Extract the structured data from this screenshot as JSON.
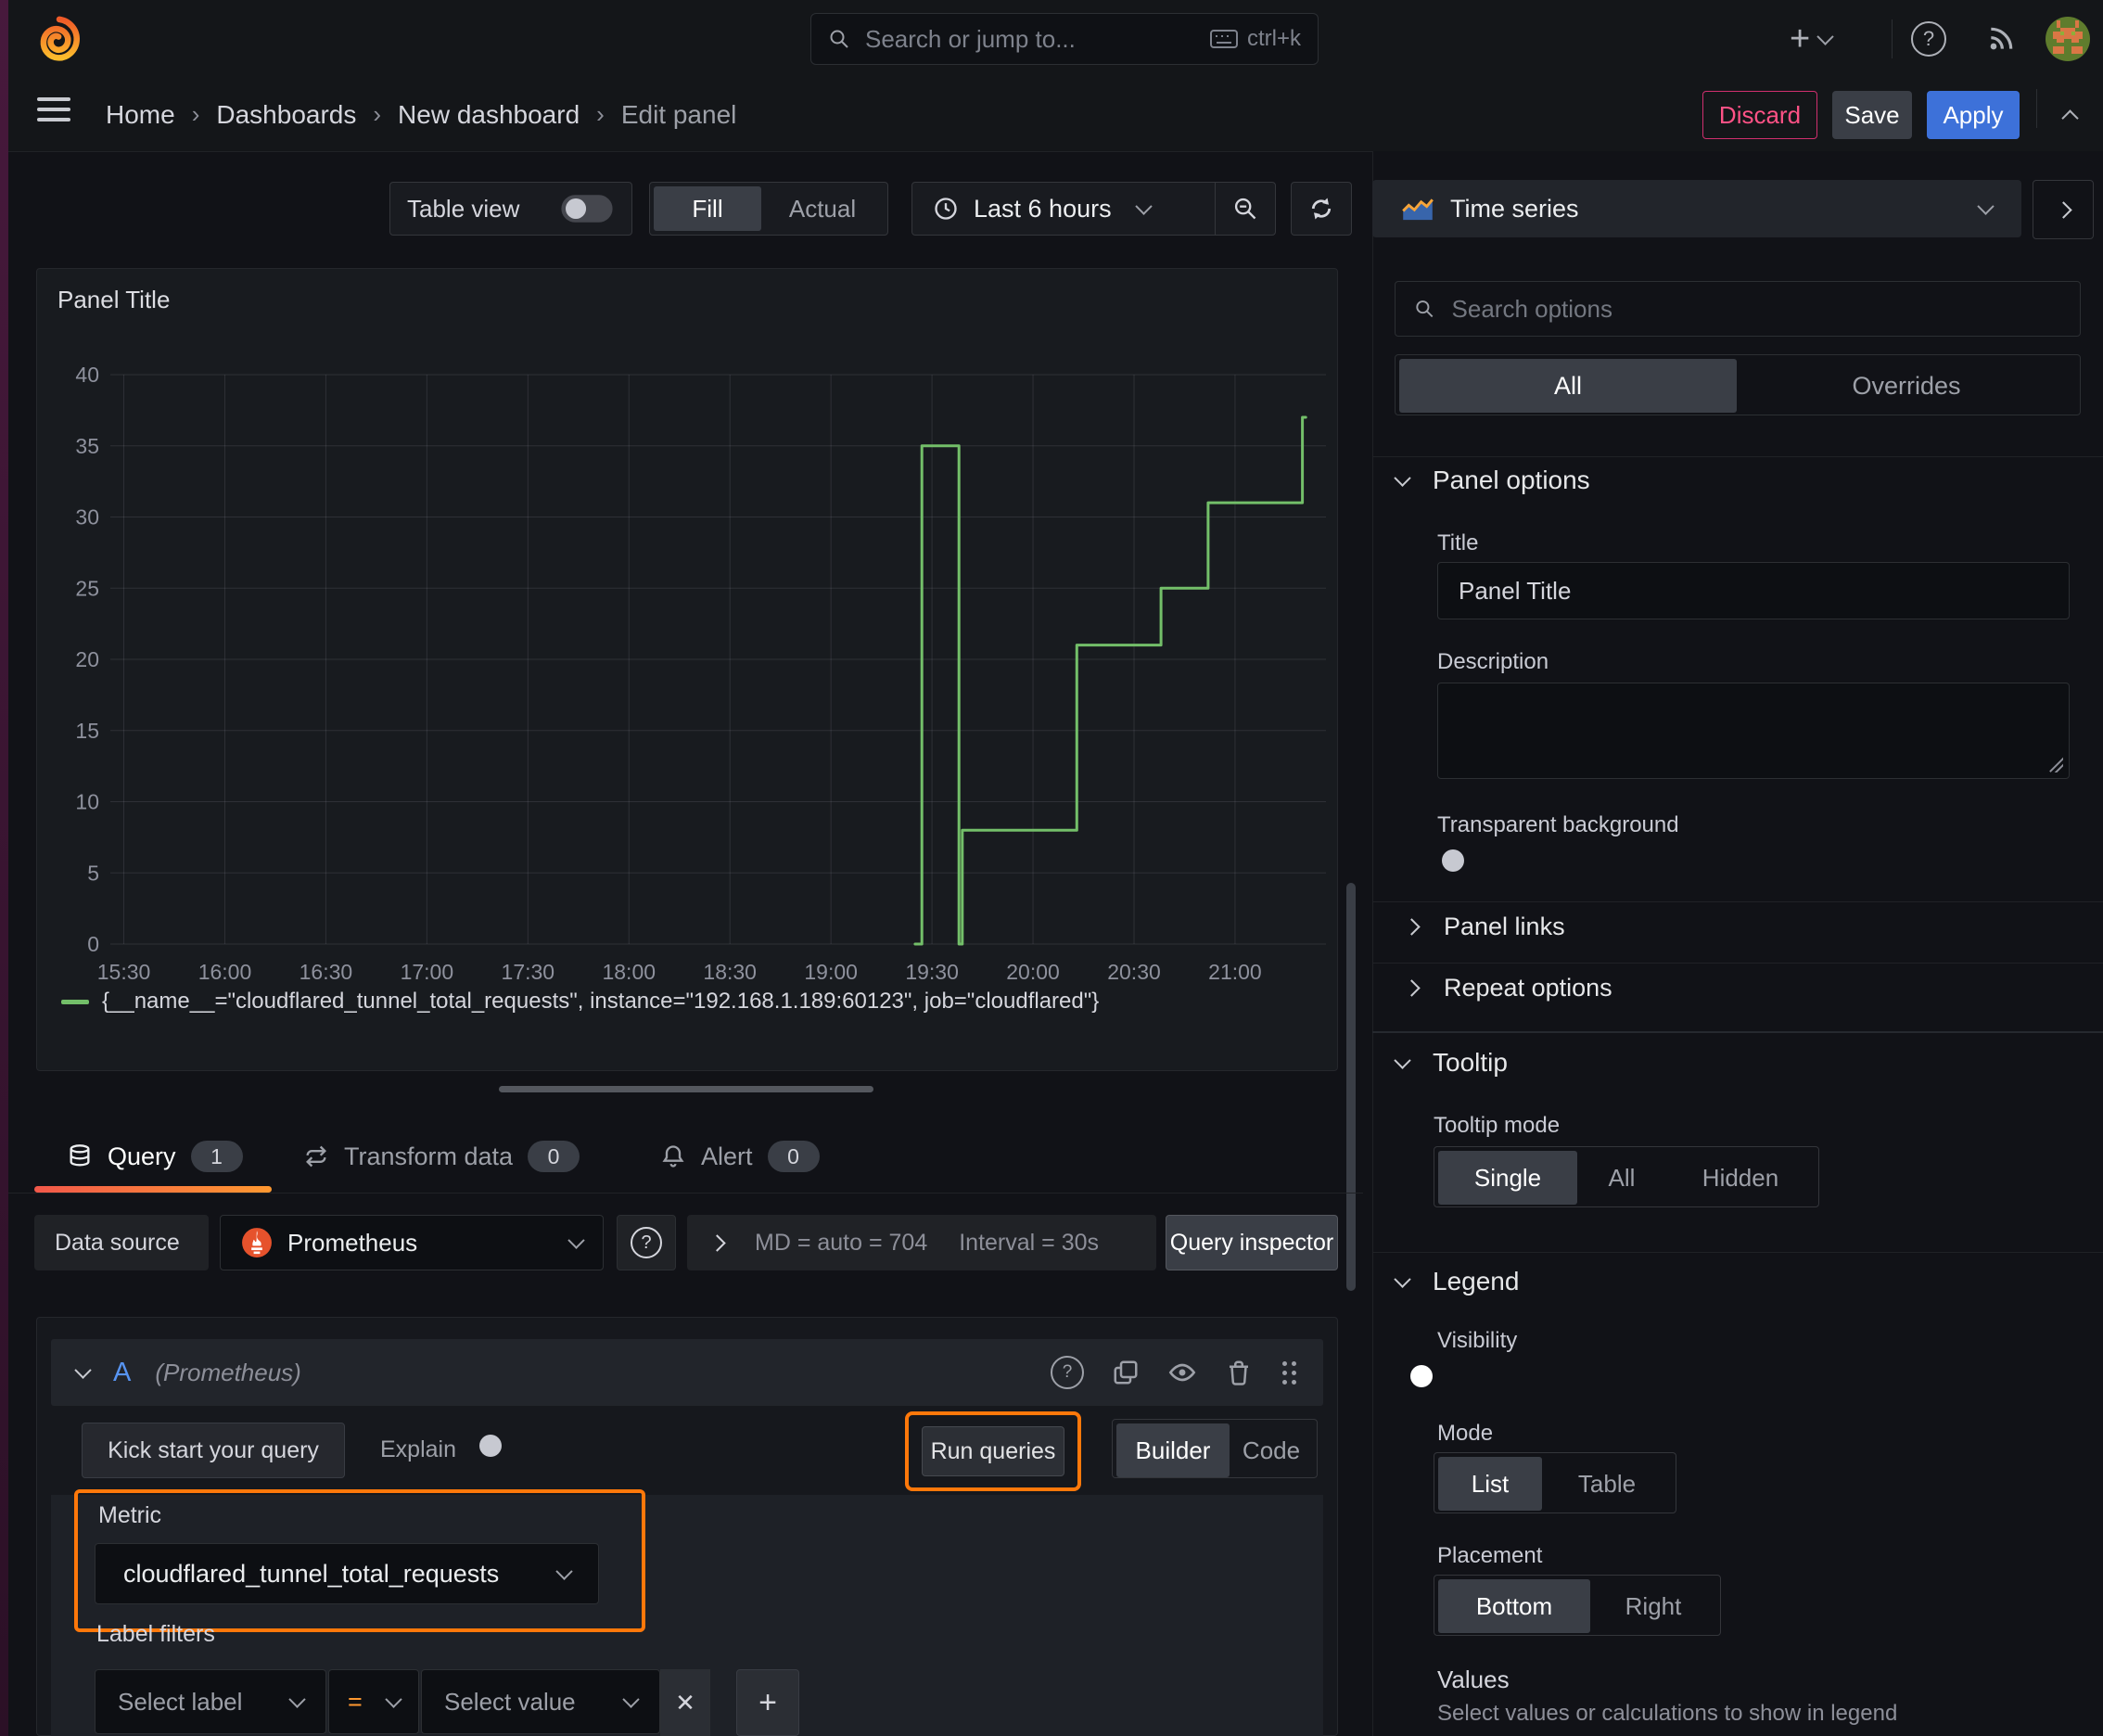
{
  "icons": {
    "separator": "›",
    "plus": "+",
    "close": "✕",
    "question": "?"
  },
  "topnav": {
    "search_placeholder": "Search or jump to...",
    "shortcut": "ctrl+k"
  },
  "breadcrumb": {
    "items": [
      "Home",
      "Dashboards",
      "New dashboard",
      "Edit panel"
    ],
    "discard": "Discard",
    "save": "Save",
    "apply": "Apply"
  },
  "toolbar": {
    "table_view": "Table view",
    "fill": "Fill",
    "actual": "Actual",
    "time_range": "Last 6 hours"
  },
  "panel": {
    "title": "Panel Title"
  },
  "chart_data": {
    "type": "line",
    "step": true,
    "title": "Panel Title",
    "xlabel": "",
    "ylabel": "",
    "grid": true,
    "legend_position": "bottom",
    "ylim": [
      0,
      40
    ],
    "y_ticks": [
      0,
      5,
      10,
      15,
      20,
      25,
      30,
      35,
      40
    ],
    "x_ticks": [
      "15:30",
      "16:00",
      "16:30",
      "17:00",
      "17:30",
      "18:00",
      "18:30",
      "19:00",
      "19:30",
      "20:00",
      "20:30",
      "21:00"
    ],
    "x_domain": [
      "15:26",
      "21:27"
    ],
    "series": [
      {
        "label": "{__name__=\"cloudflared_tunnel_total_requests\", instance=\"192.168.1.189:60123\", job=\"cloudflared\"}",
        "color": "#73BF69",
        "points": [
          [
            "19:25",
            0
          ],
          [
            "19:27",
            0
          ],
          [
            "19:27",
            35
          ],
          [
            "19:38",
            35
          ],
          [
            "19:38",
            0
          ],
          [
            "19:39",
            0
          ],
          [
            "19:39",
            8
          ],
          [
            "20:13",
            8
          ],
          [
            "20:13",
            21
          ],
          [
            "20:38",
            21
          ],
          [
            "20:38",
            25
          ],
          [
            "20:52",
            25
          ],
          [
            "20:52",
            31
          ],
          [
            "21:20",
            31
          ],
          [
            "21:20",
            37
          ],
          [
            "21:21",
            37
          ]
        ]
      }
    ]
  },
  "tabs": {
    "query": {
      "label": "Query",
      "count": "1"
    },
    "transform": {
      "label": "Transform data",
      "count": "0"
    },
    "alert": {
      "label": "Alert",
      "count": "0"
    }
  },
  "datasource": {
    "label": "Data source",
    "value": "Prometheus",
    "md": "MD = auto = 704",
    "interval": "Interval = 30s",
    "inspector": "Query inspector"
  },
  "query": {
    "ref_id": "A",
    "ds_hint": "(Prometheus)",
    "kickstart": "Kick start your query",
    "explain": "Explain",
    "run": "Run queries",
    "builder": "Builder",
    "code": "Code",
    "metric_label": "Metric",
    "metric_value": "cloudflared_tunnel_total_requests",
    "label_filters": "Label filters",
    "select_label": "Select label",
    "operator": "=",
    "select_value": "Select value"
  },
  "sidebar": {
    "viz": "Time series",
    "search_placeholder": "Search options",
    "tab_all": "All",
    "tab_overrides": "Overrides",
    "panel_options": "Panel options",
    "title_label": "Title",
    "title_value": "Panel Title",
    "description_label": "Description",
    "transparent_label": "Transparent background",
    "panel_links": "Panel links",
    "repeat_options": "Repeat options",
    "tooltip": "Tooltip",
    "tooltip_mode": "Tooltip mode",
    "single": "Single",
    "all": "All",
    "hidden": "Hidden",
    "legend": "Legend",
    "visibility": "Visibility",
    "mode": "Mode",
    "list": "List",
    "table": "Table",
    "placement": "Placement",
    "bottom": "Bottom",
    "right": "Right",
    "values_label": "Values",
    "values_help": "Select values or calculations to show in legend"
  }
}
